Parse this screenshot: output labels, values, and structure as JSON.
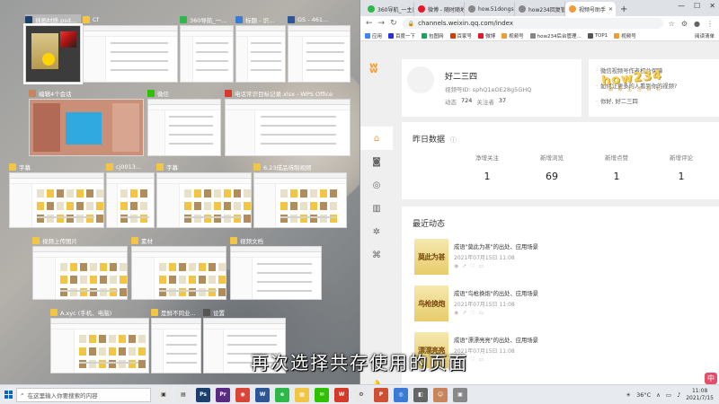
{
  "subtitle": "再次选择共存使用的页面",
  "task_view": {
    "windows": [
      {
        "id": "ps",
        "title": "插画材质.psd...",
        "icon": "photoshop-icon",
        "color": "#1c3f6e"
      },
      {
        "id": "cf",
        "title": "Cf",
        "icon": "folder-icon",
        "color": "#f3c545"
      },
      {
        "id": "360a",
        "title": "360导航_一...",
        "icon": "360-browser-icon",
        "color": "#2eb84a"
      },
      {
        "id": "biaoti",
        "title": "标题 - 识...",
        "icon": "document-icon",
        "color": "#3a7bd5"
      },
      {
        "id": "gs",
        "title": "GS - 461...",
        "icon": "word-icon",
        "color": "#2b5797"
      },
      {
        "id": "chat4",
        "title": "编辑4个会话",
        "icon": "avatar-icon",
        "color": "#c7855e"
      },
      {
        "id": "wechat",
        "title": "微信",
        "icon": "wechat-icon",
        "color": "#2dc100"
      },
      {
        "id": "wps",
        "title": "电话常识目标记录.xlsx - WPS Office",
        "icon": "wps-icon",
        "color": "#d6392a"
      },
      {
        "id": "zimu1",
        "title": "字幕",
        "icon": "folder-icon",
        "color": "#f3c545"
      },
      {
        "id": "cj",
        "title": "cj0013...",
        "icon": "folder-icon",
        "color": "#f3c545"
      },
      {
        "id": "zimu2",
        "title": "字幕",
        "icon": "folder-icon",
        "color": "#f3c545"
      },
      {
        "id": "video623",
        "title": "6.23成品待制视频",
        "icon": "folder-icon",
        "color": "#f3c545"
      },
      {
        "id": "upload",
        "title": "视频上传图片",
        "icon": "folder-icon",
        "color": "#f3c545"
      },
      {
        "id": "sucai",
        "title": "素材",
        "icon": "folder-icon",
        "color": "#f3c545"
      },
      {
        "id": "wendang",
        "title": "视频文档",
        "icon": "folder-icon",
        "color": "#f3c545"
      },
      {
        "id": "axyc",
        "title": "A.xyc (手机、电脑)",
        "icon": "folder-icon",
        "color": "#f3c545"
      },
      {
        "id": "meiyou",
        "title": "是鲜不同业...",
        "icon": "folder-icon",
        "color": "#f3c545"
      },
      {
        "id": "settings",
        "title": "设置",
        "icon": "gear-icon",
        "color": "#555555"
      }
    ]
  },
  "browser": {
    "tabs": [
      {
        "title": "360导航_一主页",
        "icon": "360-icon",
        "color": "#2eb84a"
      },
      {
        "title": "微博 - 随时随地发现",
        "icon": "weibo-icon",
        "color": "#e6162d"
      },
      {
        "title": "how.51dongshi.c...",
        "icon": "globe-icon",
        "color": "#888888"
      },
      {
        "title": "how234回复管...",
        "icon": "globe-icon",
        "color": "#888888"
      },
      {
        "title": "视频号助手",
        "icon": "channels-icon",
        "color": "#f29c38"
      }
    ],
    "address": "channels.weixin.qq.com/index",
    "bookmarks": [
      {
        "label": "应用",
        "color": "#4285f4"
      },
      {
        "label": "百度一下",
        "color": "#2932e1"
      },
      {
        "label": "包图网",
        "color": "#1aa260"
      },
      {
        "label": "百家号",
        "color": "#d83b01"
      },
      {
        "label": "微博",
        "color": "#e6162d"
      },
      {
        "label": "视频号",
        "color": "#f29c38"
      },
      {
        "label": "how234后台管理...",
        "color": "#888888"
      },
      {
        "label": "TOP1",
        "color": "#555555"
      },
      {
        "label": "视频号",
        "color": "#f29c38"
      }
    ],
    "reading_list": "阅读清单",
    "watermark": "how234",
    "watermark_sub": "精 致 生 活 百 科",
    "profile": {
      "name": "好二三四",
      "id_label": "视频号ID: sphQ1eOE28g5GHQ",
      "dynamics_label": "动态",
      "dynamics": "724",
      "followers_label": "关注者",
      "followers": "37"
    },
    "help_links": [
      "微信视频号作者权益保障",
      "如何让更多的人看到你的视频?",
      "你好, 好二三四"
    ],
    "yesterday": {
      "title": "昨日数据",
      "stats": [
        {
          "label": "净增关注",
          "value": "1"
        },
        {
          "label": "新增浏览",
          "value": "69"
        },
        {
          "label": "新增点赞",
          "value": "1"
        },
        {
          "label": "新增评论",
          "value": "1"
        }
      ]
    },
    "recent": {
      "title": "最近动态",
      "items": [
        {
          "thumb": "莫此为甚",
          "text": "成语\"莫此为甚\"的出处、应用场景",
          "time": "2021年07月15日 11:08"
        },
        {
          "thumb": "鸟枪换炮",
          "text": "成语\"鸟枪换炮\"的出处、应用场景",
          "time": "2021年07月15日 11:08"
        },
        {
          "thumb": "漂漂亮亮",
          "text": "成语\"漂漂亮亮\"的出处、应用场景",
          "time": "2021年07月15日 11:08"
        }
      ]
    }
  },
  "taskbar": {
    "search_placeholder": "在这里输入你要搜索的内容",
    "temperature": "36°C",
    "time": "11:08",
    "date": "2021/7/15",
    "badge": "中"
  }
}
